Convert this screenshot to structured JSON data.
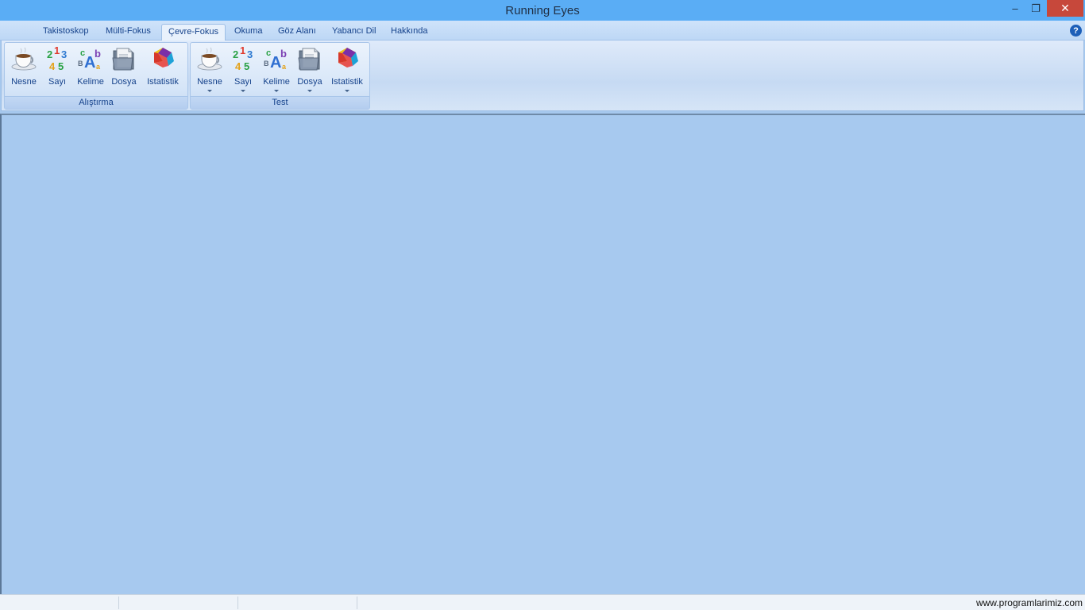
{
  "window": {
    "title": "Running Eyes"
  },
  "window_controls": {
    "minimize": "–",
    "maximize": "❐",
    "close": "✕"
  },
  "tabs": [
    {
      "label": "Takistoskop",
      "active": false
    },
    {
      "label": "Mülti-Fokus",
      "active": false
    },
    {
      "label": "Çevre-Fokus",
      "active": true
    },
    {
      "label": "Okuma",
      "active": false
    },
    {
      "label": "Göz Alanı",
      "active": false
    },
    {
      "label": "Yabancı Dil",
      "active": false
    },
    {
      "label": "Hakkında",
      "active": false
    }
  ],
  "help": {
    "glyph": "?"
  },
  "ribbon": {
    "groups": [
      {
        "label": "Alıştırma",
        "buttons": [
          {
            "label": "Nesne",
            "icon": "teacup-icon",
            "dropdown": false
          },
          {
            "label": "Sayı",
            "icon": "numbers-icon",
            "dropdown": false
          },
          {
            "label": "Kelime",
            "icon": "letters-icon",
            "dropdown": false
          },
          {
            "label": "Dosya",
            "icon": "file-icon",
            "dropdown": false
          },
          {
            "label": "Istatistik",
            "icon": "statistics-icon",
            "dropdown": false
          }
        ]
      },
      {
        "label": "Test",
        "buttons": [
          {
            "label": "Nesne",
            "icon": "teacup-icon",
            "dropdown": true
          },
          {
            "label": "Sayı",
            "icon": "numbers-icon",
            "dropdown": true
          },
          {
            "label": "Kelime",
            "icon": "letters-icon",
            "dropdown": true
          },
          {
            "label": "Dosya",
            "icon": "file-icon",
            "dropdown": true
          },
          {
            "label": "Istatistik",
            "icon": "statistics-icon",
            "dropdown": true
          }
        ]
      }
    ]
  },
  "icon_text": {
    "n1": "1",
    "n2": "2",
    "n3": "3",
    "n4": "4",
    "n5": "5",
    "lc": "c",
    "la": "A",
    "lb": "b",
    "lB": "B",
    "lr": "a"
  },
  "colors": {
    "titlebar": "#5aadf5",
    "close_button": "#c7483b",
    "workspace": "#a7c9ef",
    "text": "#15428b"
  },
  "status_bar": {
    "text": "www.programlarimiz.com"
  }
}
